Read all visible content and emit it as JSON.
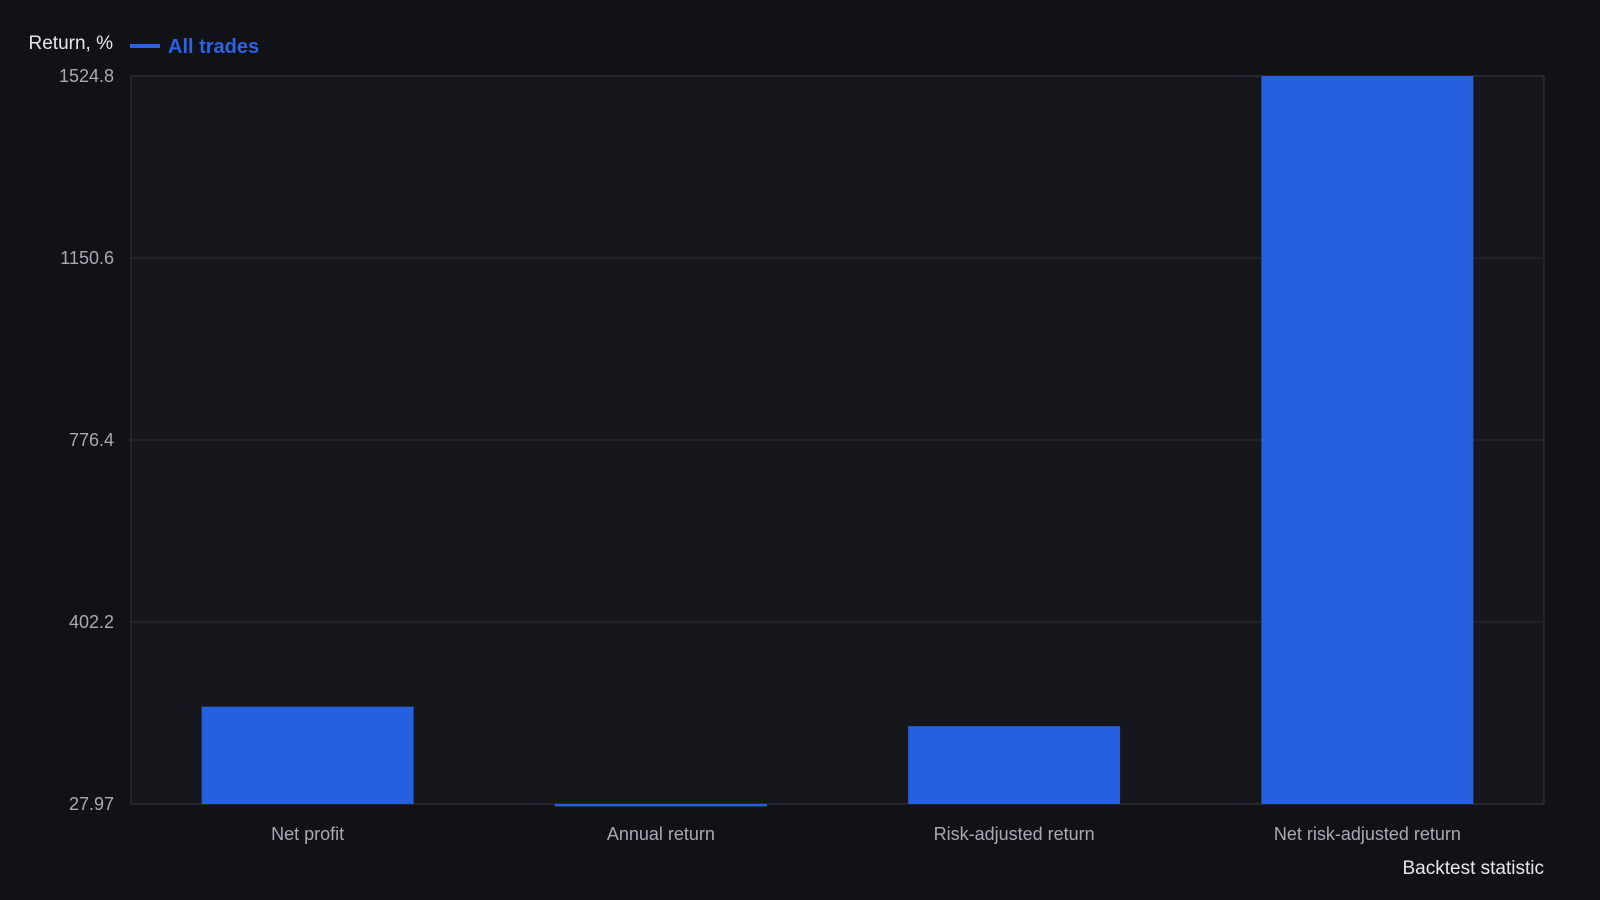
{
  "chart_data": {
    "type": "bar",
    "ylabel": "Return, %",
    "xlabel": "Backtest statistic",
    "legend": {
      "position": "top-left",
      "entries": [
        "All trades"
      ]
    },
    "y_ticks": [
      "1524.8",
      "1150.6",
      "776.4",
      "402.2",
      "27.97"
    ],
    "ylim": [
      27.97,
      1524.8
    ],
    "grid": true,
    "categories": [
      "Net profit",
      "Annual return",
      "Risk-adjusted return",
      "Net risk-adjusted return"
    ],
    "series": [
      {
        "name": "All trades",
        "values": [
          228,
          23,
          188,
          1524.8
        ]
      }
    ]
  },
  "colors": {
    "background": "#111217",
    "plot_background": "#16171c",
    "grid": "#2a2b31",
    "bar": "#2560e0",
    "legend_text": "#2d62e6"
  }
}
